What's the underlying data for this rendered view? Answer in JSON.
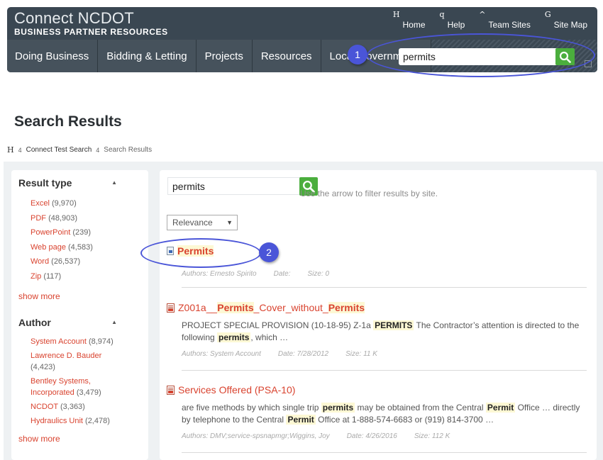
{
  "header": {
    "brand_title": "Connect NCDOT",
    "brand_subtitle": "BUSINESS PARTNER RESOURCES",
    "utility_links": [
      {
        "icon": "H",
        "label": "Home"
      },
      {
        "icon": "q",
        "label": "Help"
      },
      {
        "icon": "^",
        "label": "Team Sites"
      },
      {
        "icon": "G",
        "label": "Site Map"
      }
    ],
    "nav_items": [
      "Doing Business",
      "Bidding & Letting",
      "Projects",
      "Resources",
      "Local Governments"
    ],
    "search_value": "permits"
  },
  "callouts": [
    "1",
    "2"
  ],
  "page_title": "Search Results",
  "breadcrumb": {
    "home_icon": "H",
    "sep": "4",
    "items": [
      "Connect Test Search",
      "Search Results"
    ]
  },
  "sidebar": {
    "result_type": {
      "heading": "Result type",
      "items": [
        {
          "label": "Excel",
          "count": "(9,970)"
        },
        {
          "label": "PDF",
          "count": "(48,903)"
        },
        {
          "label": "PowerPoint",
          "count": "(239)"
        },
        {
          "label": "Web page",
          "count": "(4,583)"
        },
        {
          "label": "Word",
          "count": "(26,537)"
        },
        {
          "label": "Zip",
          "count": "(117)"
        }
      ],
      "show_more": "show more"
    },
    "author": {
      "heading": "Author",
      "items": [
        {
          "label": "System Account",
          "count": "(8,974)"
        },
        {
          "label": "Lawrence D. Bauder",
          "count": "(4,423)"
        },
        {
          "label": "Bentley Systems, Incorporated",
          "count": "(3,479)"
        },
        {
          "label": "NCDOT",
          "count": "(3,363)"
        },
        {
          "label": "Hydraulics Unit",
          "count": "(2,478)"
        }
      ],
      "show_more": "show more"
    }
  },
  "main": {
    "search_value": "permits",
    "hint": "Use the arrow to filter results by site.",
    "sort_label": "Relevance",
    "results": [
      {
        "title_parts": [
          "Permits"
        ],
        "meta": [
          "Authors: Ernesto Spirito",
          "Date:",
          "Size: 0"
        ]
      },
      {
        "title_parts": [
          "Z001a__",
          "Permits",
          "_Cover_without_",
          "Permits"
        ],
        "snippet": {
          "p1": "PROJECT SPECIAL PROVISION (10-18-95) Z-1a ",
          "h1": "PERMITS",
          "p2": " The Contractor’s attention is directed to the following ",
          "h2": "permits",
          "p3": ", which …"
        },
        "meta": [
          "Authors: System Account",
          "Date: 7/28/2012",
          "Size: 11 K"
        ]
      },
      {
        "title": "Services Offered (PSA-10)",
        "snippet": {
          "p1": "are five methods by which single trip ",
          "h1": "permits",
          "p2": " may be obtained from the Central ",
          "h2": "Permit",
          "p3": " Office … directly by telephone to the Central ",
          "h3": "Permit",
          "p4": " Office at 1-888-574-6683 or (919) 814-3700 …"
        },
        "meta": [
          "Authors: DMV;service-spsnapmgr;Wiggins, Joy",
          "Date: 4/26/2016",
          "Size: 112 K"
        ]
      }
    ]
  }
}
